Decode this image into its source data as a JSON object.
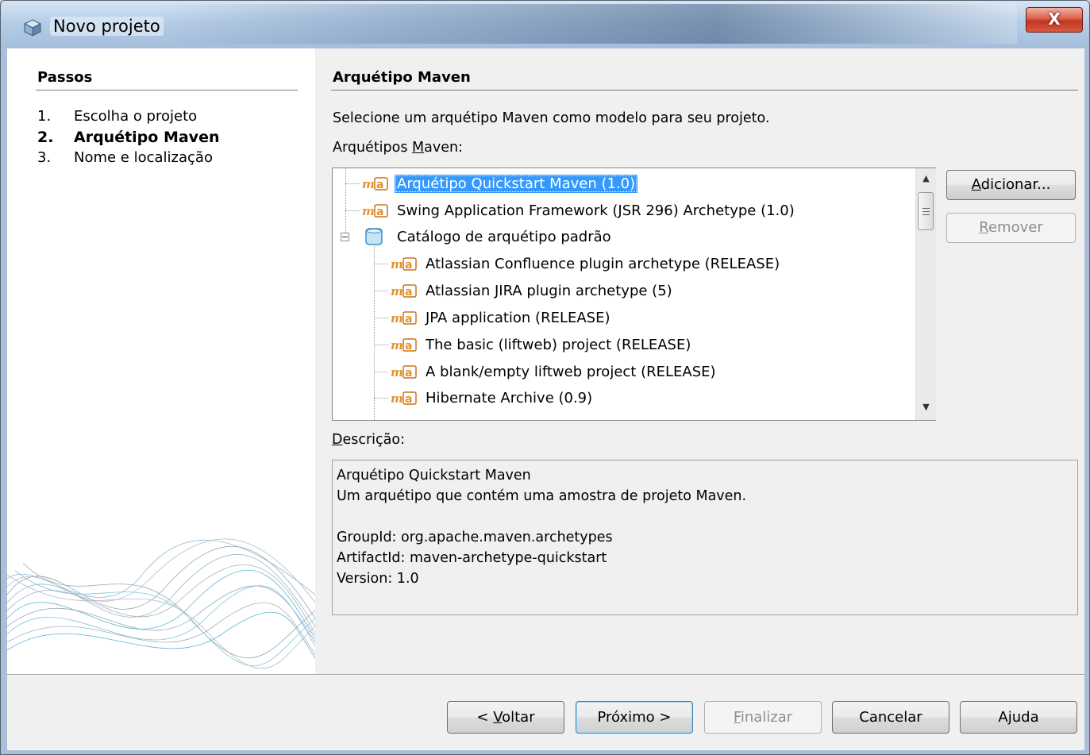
{
  "window": {
    "title": "Novo projeto",
    "close_label": "X"
  },
  "steps_panel": {
    "title": "Passos",
    "steps": [
      {
        "num": "1.",
        "label": "Escolha o projeto",
        "active": false
      },
      {
        "num": "2.",
        "label": "Arquétipo Maven",
        "active": true
      },
      {
        "num": "3.",
        "label": "Nome e localização",
        "active": false
      }
    ]
  },
  "main": {
    "title": "Arquétipo Maven",
    "instruction": "Selecione um arquétipo Maven como modelo para seu projeto.",
    "list_label_pre": "Arquétipos ",
    "list_label_mnemonic": "M",
    "list_label_post": "aven:",
    "tree": [
      {
        "label": "Arquétipo Quickstart Maven (1.0)",
        "icon": "maven-icon",
        "level": 0,
        "selected": true
      },
      {
        "label": "Swing Application Framework (JSR 296) Archetype (1.0)",
        "icon": "maven-icon",
        "level": 0,
        "selected": false
      },
      {
        "label": "Catálogo de arquétipo padrão",
        "icon": "database-icon",
        "level": 0,
        "selected": false,
        "expanded": true
      },
      {
        "label": "Atlassian Confluence plugin archetype (RELEASE)",
        "icon": "maven-icon",
        "level": 1,
        "selected": false
      },
      {
        "label": "Atlassian JIRA plugin archetype (5)",
        "icon": "maven-icon",
        "level": 1,
        "selected": false
      },
      {
        "label": "JPA application (RELEASE)",
        "icon": "maven-icon",
        "level": 1,
        "selected": false
      },
      {
        "label": "The basic (liftweb) project (RELEASE)",
        "icon": "maven-icon",
        "level": 1,
        "selected": false
      },
      {
        "label": "A blank/empty liftweb project (RELEASE)",
        "icon": "maven-icon",
        "level": 1,
        "selected": false
      },
      {
        "label": "Hibernate Archive (0.9)",
        "icon": "maven-icon",
        "level": 1,
        "selected": false
      }
    ],
    "buttons": {
      "add_mnemonic": "A",
      "add_rest": "dicionar...",
      "remove_mnemonic": "R",
      "remove_rest": "emover"
    },
    "description_label_mnemonic": "D",
    "description_label_rest": "escrição:",
    "description_lines": [
      "Arquétipo Quickstart Maven",
      "Um arquétipo que contém uma amostra de projeto Maven.",
      "",
      "GroupId: org.apache.maven.archetypes",
      "ArtifactId: maven-archetype-quickstart",
      "Version: 1.0"
    ]
  },
  "footer": {
    "back_pre": "< ",
    "back_mnemonic": "V",
    "back_rest": "oltar",
    "next_label": "Próximo >",
    "finish_mnemonic": "F",
    "finish_rest": "inalizar",
    "cancel_label": "Cancelar",
    "help_pre": "A",
    "help_mnemonic": "j",
    "help_rest": "uda"
  },
  "colors": {
    "selection": "#3399ff",
    "maven_icon": "#e8912c"
  }
}
